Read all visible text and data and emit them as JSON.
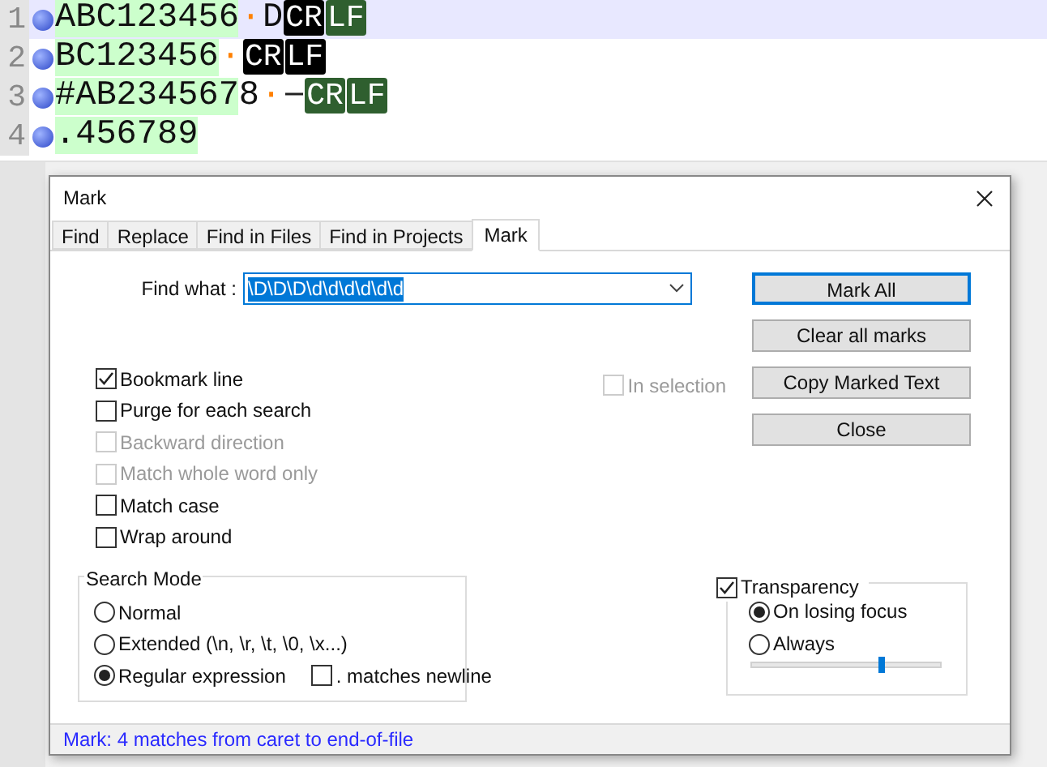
{
  "editor": {
    "lines": [
      {
        "number": "1",
        "current": true,
        "bookmarked": true,
        "segments": [
          {
            "kind": "text",
            "text": "ABC123456",
            "marked": true
          },
          {
            "kind": "space",
            "text": "·"
          },
          {
            "kind": "text",
            "text": "D",
            "marked": false
          },
          {
            "kind": "eol",
            "text": "CR",
            "color": "#000000"
          },
          {
            "kind": "eol",
            "text": "LF",
            "color": "#2f5f2f"
          }
        ]
      },
      {
        "number": "2",
        "current": false,
        "bookmarked": true,
        "segments": [
          {
            "kind": "text",
            "text": "BC123456",
            "marked": true
          },
          {
            "kind": "space",
            "text": "·"
          },
          {
            "kind": "eol",
            "text": "CR",
            "color": "#000000"
          },
          {
            "kind": "eol",
            "text": "LF",
            "color": "#000000"
          }
        ]
      },
      {
        "number": "3",
        "current": false,
        "bookmarked": true,
        "segments": [
          {
            "kind": "text",
            "text": "#AB234567",
            "marked": true
          },
          {
            "kind": "text",
            "text": "8",
            "marked": false
          },
          {
            "kind": "space",
            "text": "·"
          },
          {
            "kind": "tab"
          },
          {
            "kind": "eol",
            "text": "CR",
            "color": "#2f5f2f"
          },
          {
            "kind": "eol",
            "text": "LF",
            "color": "#2f5f2f"
          }
        ]
      },
      {
        "number": "4",
        "current": false,
        "bookmarked": true,
        "segments": [
          {
            "kind": "text",
            "text": ".456789",
            "marked": true
          }
        ]
      }
    ]
  },
  "dialog": {
    "title": "Mark",
    "tabs": [
      {
        "label": "Find",
        "selected": false
      },
      {
        "label": "Replace",
        "selected": false
      },
      {
        "label": "Find in Files",
        "selected": false
      },
      {
        "label": "Find in Projects",
        "selected": false
      },
      {
        "label": "Mark",
        "selected": true
      }
    ],
    "find_what": {
      "label": "Find what :",
      "value": "\\D\\D\\D\\d\\d\\d\\d\\d\\d"
    },
    "buttons": [
      {
        "label": "Mark All",
        "default": true
      },
      {
        "label": "Clear all marks",
        "default": false
      },
      {
        "label": "Copy Marked Text",
        "default": false
      },
      {
        "label": "Close",
        "default": false
      }
    ],
    "in_selection": {
      "label": "In selection",
      "checked": false,
      "disabled": true
    },
    "options": [
      {
        "label": "Bookmark line",
        "checked": true,
        "disabled": false
      },
      {
        "label": "Purge for each search",
        "checked": false,
        "disabled": false
      },
      {
        "label": "Backward direction",
        "checked": false,
        "disabled": true
      },
      {
        "label": "Match whole word only",
        "checked": false,
        "disabled": true
      },
      {
        "label": "Match case",
        "checked": false,
        "disabled": false
      },
      {
        "label": "Wrap around",
        "checked": false,
        "disabled": false
      }
    ],
    "search_mode": {
      "title": "Search Mode",
      "modes": [
        {
          "label": "Normal",
          "selected": false
        },
        {
          "label": "Extended (\\n, \\r, \\t, \\0, \\x...)",
          "selected": false
        },
        {
          "label": "Regular expression",
          "selected": true
        }
      ],
      "matches_newline": {
        "label": ". matches newline",
        "checked": false
      }
    },
    "transparency": {
      "label": "Transparency",
      "checked": true,
      "modes": [
        {
          "label": "On losing focus",
          "selected": true
        },
        {
          "label": "Always",
          "selected": false
        }
      ],
      "level": 0.69
    },
    "status": "Mark: 4 matches from caret to end-of-file"
  }
}
